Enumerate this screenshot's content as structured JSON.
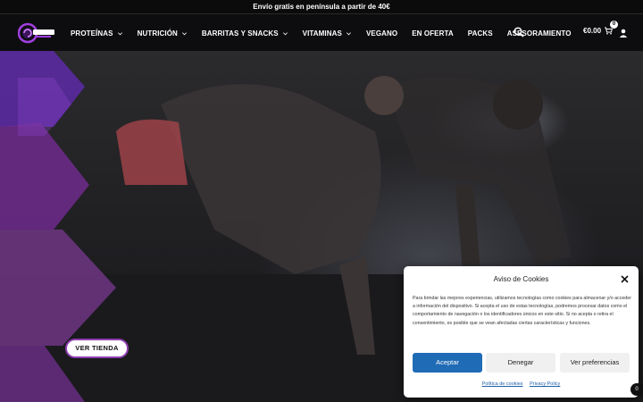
{
  "topbar": {
    "text": "Envío gratis en península a partir de 40€"
  },
  "header": {
    "logo_alt": "logo",
    "nav": [
      {
        "label": "PROTEÍNAS",
        "has_dropdown": true
      },
      {
        "label": "NUTRICIÓN",
        "has_dropdown": true
      },
      {
        "label": "BARRITAS Y SNACKS",
        "has_dropdown": true
      },
      {
        "label": "VITAMINAS",
        "has_dropdown": true
      },
      {
        "label": "VEGANO",
        "has_dropdown": false
      },
      {
        "label": "EN OFERTA",
        "has_dropdown": false
      },
      {
        "label": "PACKS",
        "has_dropdown": false
      },
      {
        "label": "ASESORAMIENTO",
        "has_dropdown": false
      }
    ],
    "cart_total": "€0.00",
    "cart_count": "0",
    "icons": {
      "search": "search-icon",
      "cart": "cart-icon",
      "user": "user-icon"
    }
  },
  "hero": {
    "button_label": "VER TIENDA"
  },
  "cookie": {
    "title": "Aviso de Cookies",
    "body": "Para brindar las mejores experiencias, utilizamos tecnologías como cookies para almacenar y/o acceder a información del dispositivo. Si acepta el uso de estas tecnologías, podremos procesar datos como el comportamiento de navegación o los identificadores únicos en este sitio. Si no acepta o retira el consentimiento, es posible que se vean afectadas ciertas características y funciones.",
    "accept": "Aceptar",
    "deny": "Denegar",
    "preferences": "Ver preferencias",
    "link_cookies": "Política de cookies",
    "link_privacy": "Privacy Policy"
  },
  "side_badge": "0",
  "colors": {
    "accent": "#8e3fb2",
    "button_blue": "#1f6bb5",
    "header_bg": "#0c0c0e"
  }
}
